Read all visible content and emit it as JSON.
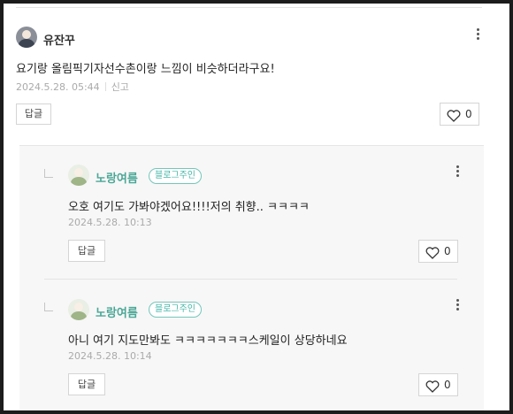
{
  "comments": [
    {
      "author": "유잔꾸",
      "text": "요기랑 올림픽기자선수촌이랑 느낌이 비슷하더라구요!",
      "date": "2024.5.28. 05:44",
      "report_label": "신고",
      "reply_label": "답글",
      "like_count": "0",
      "avatar_icon": "user-avatar-icon"
    }
  ],
  "replies": [
    {
      "author": "노랑여름",
      "badge": "블로그주인",
      "text": "오호 여기도 가봐야겠어요!!!!저의 취향.. ㅋㅋㅋㅋ",
      "date": "2024.5.28. 10:13",
      "reply_label": "답글",
      "like_count": "0"
    },
    {
      "author": "노랑여름",
      "badge": "블로그주인",
      "text": "아니 여기 지도만봐도 ㅋㅋㅋㅋㅋㅋㅋ스케일이 상당하네요",
      "date": "2024.5.28. 10:14",
      "reply_label": "답글",
      "like_count": "0"
    }
  ],
  "colors": {
    "blog_owner": "#4aa796",
    "badge_border": "#74c6bb",
    "meta_gray": "#aaaaaa"
  }
}
